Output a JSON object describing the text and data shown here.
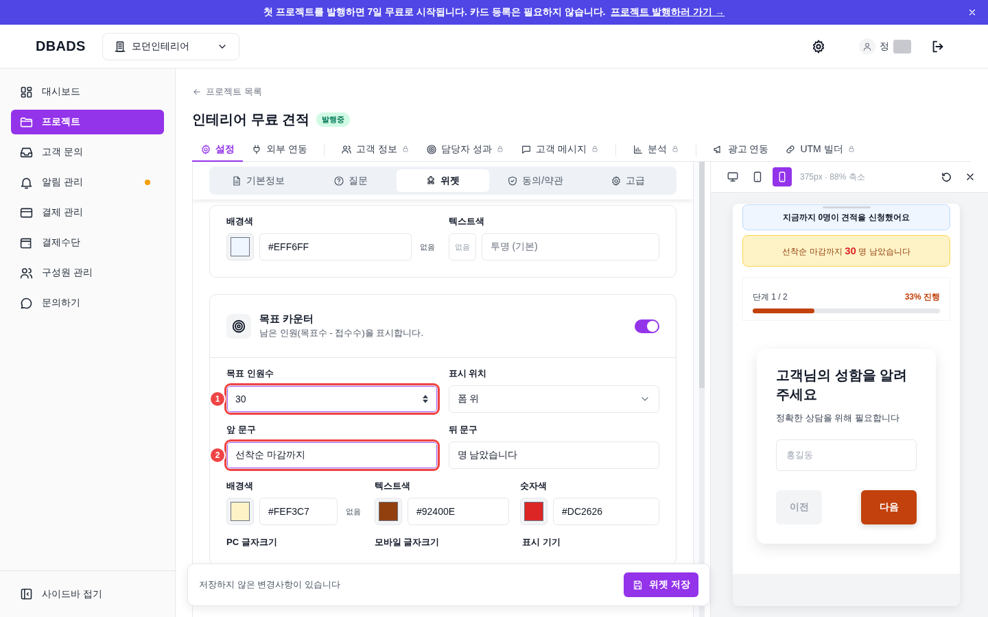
{
  "banner": {
    "message": "첫 프로젝트를 발행하면 7일 무료로 시작됩니다. 카드 등록은 필요하지 않습니다.",
    "link": "프로젝트 발행하러 가기 →"
  },
  "header": {
    "logo": "DBADS",
    "workspace": "모던인테리어",
    "user_name": "정"
  },
  "sidebar": {
    "items": [
      {
        "label": "대시보드",
        "selected": false,
        "dot": false
      },
      {
        "label": "프로젝트",
        "selected": true,
        "dot": false
      },
      {
        "label": "고객 문의",
        "selected": false,
        "dot": false
      },
      {
        "label": "알림 관리",
        "selected": false,
        "dot": true
      },
      {
        "label": "결제 관리",
        "selected": false,
        "dot": false
      },
      {
        "label": "결제수단",
        "selected": false,
        "dot": false
      },
      {
        "label": "구성원 관리",
        "selected": false,
        "dot": false
      },
      {
        "label": "문의하기",
        "selected": false,
        "dot": false
      }
    ],
    "collapse": "사이드바 접기"
  },
  "project": {
    "back": "프로젝트 목록",
    "title": "인테리어 무료 견적",
    "status": "발행중"
  },
  "tab_groups": [
    [
      {
        "label": "설정",
        "selected": true,
        "locked": false
      },
      {
        "label": "외부 연동",
        "selected": false,
        "locked": false
      }
    ],
    [
      {
        "label": "고객 정보",
        "selected": false,
        "locked": true
      },
      {
        "label": "담당자 성과",
        "selected": false,
        "locked": true
      },
      {
        "label": "고객 메시지",
        "selected": false,
        "locked": true
      }
    ],
    [
      {
        "label": "분석",
        "selected": false,
        "locked": true
      }
    ],
    [
      {
        "label": "광고 연동",
        "selected": false,
        "locked": false
      },
      {
        "label": "UTM 빌더",
        "selected": false,
        "locked": true
      }
    ]
  ],
  "sub_tabs": [
    {
      "label": "기본정보",
      "selected": false
    },
    {
      "label": "질문",
      "selected": false
    },
    {
      "label": "위젯",
      "selected": true
    },
    {
      "label": "동의/약관",
      "selected": false
    },
    {
      "label": "고급",
      "selected": false
    }
  ],
  "cards": [
    {
      "rows": [
        [
          {
            "kind": "color",
            "label": "배경색",
            "value": "#EFF6FF",
            "clear": "없음"
          },
          {
            "kind": "color_empty",
            "label": "텍스트색",
            "swatch_text": "없음",
            "placeholder": "투명 (기본)"
          }
        ]
      ]
    },
    {
      "title": "목표 카운터",
      "description": "남은 인원(목표수 - 접수수)을 표시합니다.",
      "on": true,
      "rows": [
        [
          {
            "kind": "number",
            "label": "목표 인원수",
            "value": "30",
            "marker": "1"
          },
          {
            "kind": "select",
            "label": "표시 위치",
            "value": "폼 위"
          }
        ],
        [
          {
            "kind": "text",
            "label": "앞 문구",
            "value": "선착순 마감까지",
            "marker": "2"
          },
          {
            "kind": "text",
            "label": "뒤 문구",
            "value": "명 남았습니다"
          }
        ],
        [
          {
            "kind": "color",
            "label": "배경색",
            "value": "#FEF3C7",
            "clear": "없음"
          },
          {
            "kind": "color",
            "label": "텍스트색",
            "value": "#92400E"
          },
          {
            "kind": "color",
            "label": "숫자색",
            "value": "#DC2626"
          }
        ],
        [
          {
            "kind": "label",
            "label": "PC 글자크기"
          },
          {
            "kind": "label",
            "label": "모바일 글자크기"
          },
          {
            "kind": "label",
            "label": "표시 기기"
          }
        ]
      ]
    }
  ],
  "save_bar": {
    "message": "저장하지 않은 변경사항이 있습니다",
    "button": "위젯 저장"
  },
  "preview": {
    "devices": [
      {
        "selected": false
      },
      {
        "selected": false
      },
      {
        "selected": true
      }
    ],
    "info": "375px · 88% 축소",
    "counter": "지금까지 0명이 견적을 신청했어요",
    "countdown": "선착순 마감까지 **30** 명 남았습니다",
    "step": "단계 1 / 2",
    "progress_text": "33% 진행",
    "level": 0.33,
    "question": {
      "title": "고객님의 성함을 알려주세요",
      "subtitle": "정확한 상담을 위해 필요합니다",
      "placeholder": "홍길동",
      "prev": {
        "label": "이전",
        "disabled": true
      },
      "next": "다음"
    }
  }
}
